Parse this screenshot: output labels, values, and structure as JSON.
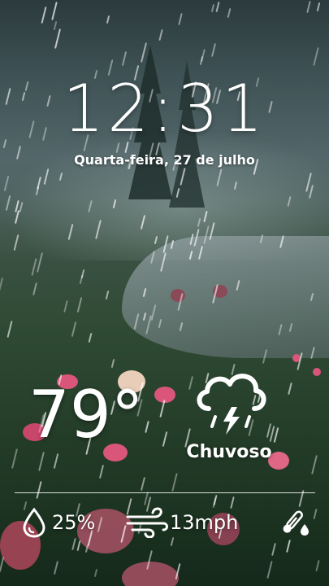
{
  "lockscreen": {
    "time": "12:31",
    "date": "Quarta-feira, 27 de julho"
  },
  "weather": {
    "temperature": "79°",
    "condition": "Chuvoso",
    "condition_icon": "thunderstorm-cloud-icon",
    "humidity": "25%",
    "humidity_icon": "water-drop-icon",
    "wind": "13mph",
    "wind_icon": "wind-icon",
    "feels_icon": "thermometer-drop-icon"
  },
  "colors": {
    "text": "#ffffff",
    "sky": "#4f6460",
    "foliage": "#26402b",
    "flower_pink": "#d9567a"
  }
}
